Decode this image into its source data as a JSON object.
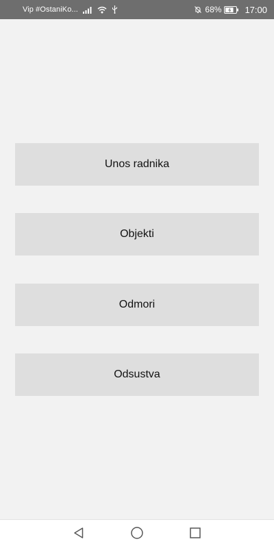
{
  "status_bar": {
    "carrier": "Vip #OstaniKo...",
    "battery_percent": "68%",
    "time": "17:00",
    "icons_left": [
      "signal-icon",
      "wifi-icon",
      "usb-icon"
    ],
    "icons_right": [
      "alarm-off-icon",
      "battery-icon"
    ]
  },
  "menu": {
    "buttons": [
      {
        "label": "Unos radnika"
      },
      {
        "label": "Objekti"
      },
      {
        "label": "Odmori"
      },
      {
        "label": "Odsustva"
      }
    ]
  },
  "nav_bar": {
    "icons": [
      "back-icon",
      "home-icon",
      "recents-icon"
    ]
  },
  "colors": {
    "status_bar_bg": "#6e6e6e",
    "screen_bg": "#f2f2f2",
    "button_bg": "#dedede",
    "nav_bar_bg": "#ffffff"
  }
}
